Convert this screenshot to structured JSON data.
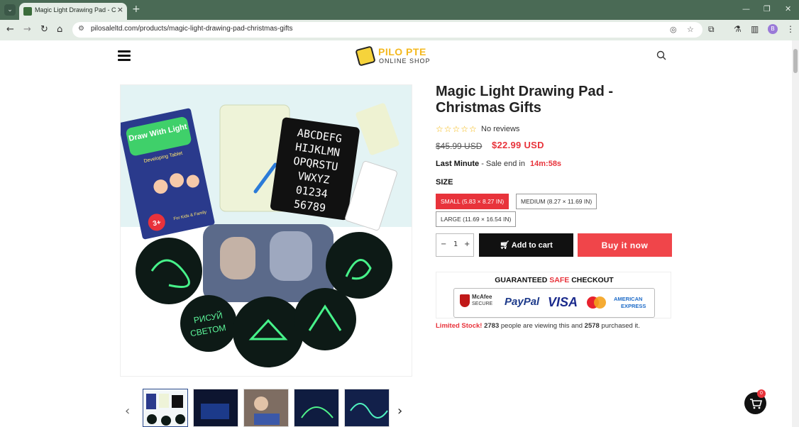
{
  "browser": {
    "tab_title": "Magic Light Drawing Pad - Christmas Gifts",
    "url": "pilosaleltd.com/products/magic-light-drawing-pad-christmas-gifts",
    "new_tab_symbol": "+",
    "profile_initial": "B"
  },
  "header": {
    "logo_name": "PILO PTE",
    "logo_sub": "ONLINE SHOP"
  },
  "product": {
    "title": "Magic Light Drawing Pad - Christmas Gifts",
    "rating_stars": "☆☆☆☆☆",
    "rating": 0,
    "reviews_text": "No reviews",
    "old_price": "$45.99 USD",
    "new_price": "$22.99 USD",
    "sale_label": "Last Minute",
    "sale_text": "- Sale end in",
    "timer": "14m:58s",
    "size_label": "SIZE",
    "sizes": [
      "SMALL (5.83 × 8.27 IN)",
      "MEDIUM (8.27 × 11.69 IN)",
      "LARGE (11.69 × 16.54 IN)"
    ],
    "selected_size": "SMALL (5.83 × 8.27 IN)",
    "quantity": "1",
    "qty_minus": "−",
    "qty_plus": "+",
    "add_to_cart": "Add to cart",
    "buy_now": "Buy it now",
    "image_text": {
      "book_title": "Draw With Light",
      "book_subtitle": "Developing Tablet",
      "book_age": "3+",
      "book_audience": "For Kids & Family",
      "letters_row1": "ABCDEFG",
      "letters_row2": "HIJKLMN",
      "letters_row3": "OPQRSTU",
      "letters_row4": "VWXYZ",
      "digits_row1": "01234",
      "digits_row2": "56789",
      "glow_text1": "РИСУЙ",
      "glow_text2": "СВЕТОМ"
    }
  },
  "checkout": {
    "title_pre": "GUARANTEED ",
    "title_safe": "SAFE",
    "title_post": " CHECKOUT",
    "mcafee": "McAfee",
    "mcafee_sub": "SECURE",
    "paypal": "PayPal",
    "visa": "VISA",
    "amex1": "AMERICAN",
    "amex2": "EXPRESS"
  },
  "stock": {
    "label": "Limited Stock!",
    "viewing": "2783",
    "middle": " people are viewing this and ",
    "purchased": "2578",
    "end": " purchased it."
  },
  "cart": {
    "count": "0"
  },
  "colors": {
    "accent_red": "#e8333b",
    "buy_red": "#f0454a",
    "logo_yellow": "#f4b81d",
    "chrome_green": "#4a6a55"
  },
  "icons": [
    "tab-menu-icon",
    "close-icon",
    "back-icon",
    "forward-icon",
    "reload-icon",
    "home-icon",
    "site-info-icon",
    "eye-off-icon",
    "star-icon",
    "extensions-icon",
    "labs-icon",
    "sidebar-icon",
    "more-icon",
    "hamburger-icon",
    "search-icon",
    "cart-icon",
    "chevron-left-icon",
    "chevron-right-icon"
  ]
}
